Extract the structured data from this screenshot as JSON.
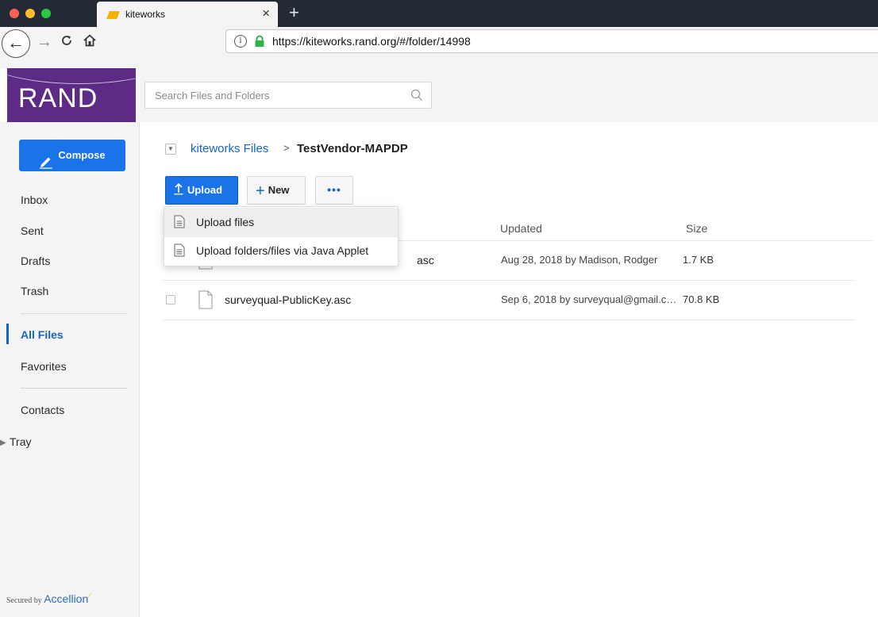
{
  "browser": {
    "tab_title": "kiteworks",
    "url": "https://kiteworks.rand.org/#/folder/14998",
    "url_info": "i"
  },
  "brand": {
    "logo_text": "RAND",
    "color": "#5d2a86"
  },
  "search": {
    "placeholder": "Search Files and Folders"
  },
  "sidebar": {
    "compose_label": "Compose",
    "items": [
      {
        "label": "Inbox"
      },
      {
        "label": "Sent"
      },
      {
        "label": "Drafts"
      },
      {
        "label": "Trash"
      },
      {
        "label": "All Files",
        "active": true
      },
      {
        "label": "Favorites"
      },
      {
        "label": "Contacts"
      },
      {
        "label": "Tray"
      }
    ],
    "footer": {
      "prefix": "Secured by",
      "brand": "Accellion"
    }
  },
  "breadcrumb": {
    "root": "kiteworks Files",
    "separator": ">",
    "current": "TestVendor-MAPDP"
  },
  "toolbar": {
    "upload_label": "Upload",
    "new_label": "New",
    "more_label": "•••"
  },
  "upload_menu": {
    "items": [
      {
        "label": "Upload files"
      },
      {
        "label": "Upload folders/files via Java Applet"
      }
    ]
  },
  "file_table": {
    "columns": {
      "updated": "Updated",
      "size": "Size"
    },
    "rows": [
      {
        "name": "asc",
        "updated": "Aug 28, 2018 by Madison, Rodger",
        "size": "1.7 KB"
      },
      {
        "name": "surveyqual-PublicKey.asc",
        "updated": "Sep 6, 2018 by surveyqual@gmail.c…",
        "size": "70.8 KB"
      }
    ]
  },
  "colors": {
    "accent": "#1a73e8",
    "link": "#1465c4"
  },
  "icons": {
    "back": "back-arrow-icon",
    "forward": "forward-arrow-icon",
    "reload": "reload-icon",
    "home": "home-icon",
    "lock": "lock-icon",
    "search": "search-icon",
    "compose": "pencil-icon",
    "upload": "upload-arrow-icon",
    "file": "document-icon"
  }
}
